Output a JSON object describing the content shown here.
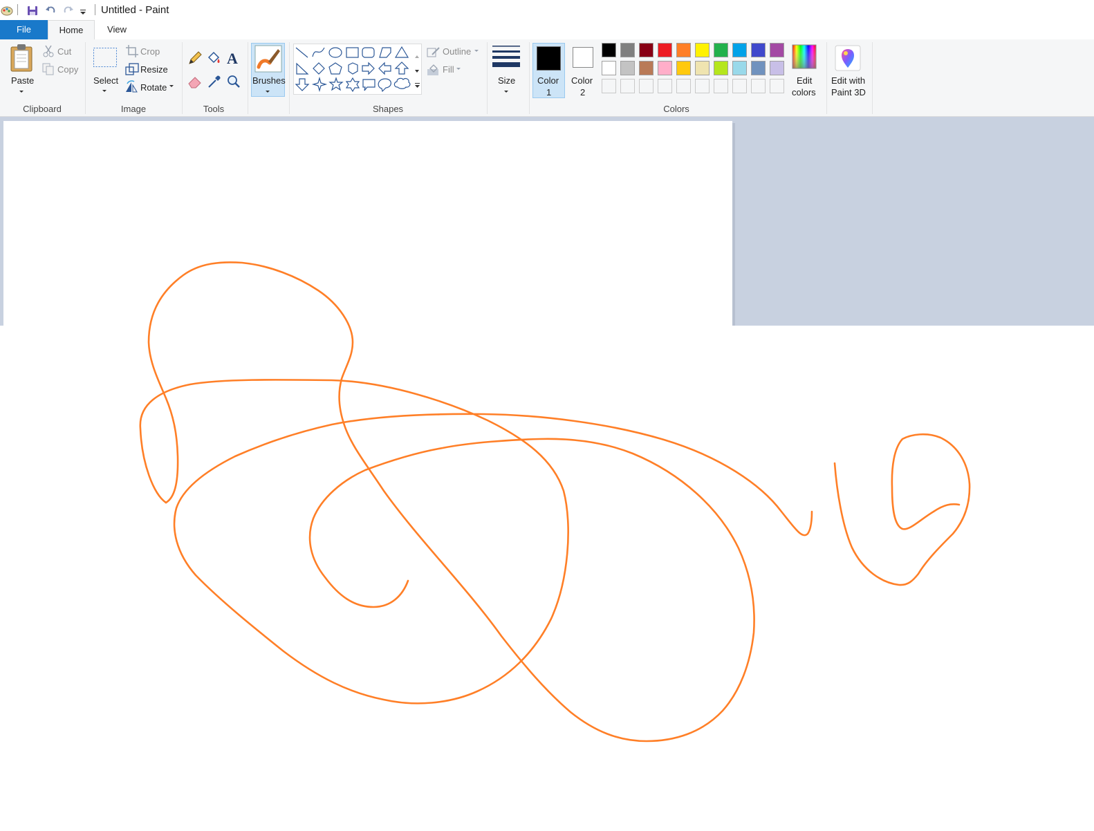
{
  "window": {
    "title": "Untitled - Paint"
  },
  "quick_access": {
    "icons": [
      "paint-app-icon",
      "save-icon",
      "undo-icon",
      "redo-icon",
      "customize-dropdown-icon"
    ]
  },
  "tabs": {
    "file": "File",
    "home": "Home",
    "view": "View",
    "active": "Home"
  },
  "ribbon": {
    "clipboard": {
      "group": "Clipboard",
      "paste": "Paste",
      "cut": "Cut",
      "copy": "Copy"
    },
    "image": {
      "group": "Image",
      "select": "Select",
      "crop": "Crop",
      "resize": "Resize",
      "rotate": "Rotate"
    },
    "tools": {
      "group": "Tools",
      "icons": [
        "pencil-icon",
        "fill-bucket-icon",
        "text-icon",
        "eraser-icon",
        "color-picker-icon",
        "magnifier-icon"
      ]
    },
    "brushes": {
      "label": "Brushes"
    },
    "shapes": {
      "group": "Shapes",
      "outline": "Outline",
      "fill": "Fill",
      "items": [
        "line",
        "curve",
        "oval",
        "rectangle",
        "rounded-rectangle",
        "polygon",
        "triangle",
        "right-triangle",
        "diamond",
        "pentagon",
        "hexagon",
        "right-arrow",
        "left-arrow",
        "up-arrow",
        "down-arrow",
        "four-point-star",
        "five-point-star",
        "six-point-star",
        "rounded-callout",
        "oval-callout",
        "cloud-callout"
      ]
    },
    "size": {
      "label": "Size"
    },
    "colors": {
      "group": "Colors",
      "color1_line1": "Color",
      "color1_line2": "1",
      "color2_line1": "Color",
      "color2_line2": "2",
      "color1_value": "#000000",
      "color2_value": "#ffffff",
      "edit_line1": "Edit",
      "edit_line2": "colors",
      "palette_row1": [
        "#000000",
        "#7f7f7f",
        "#880015",
        "#ed1c24",
        "#ff7f27",
        "#fff200",
        "#22b14c",
        "#00a2e8",
        "#3f48cc",
        "#a349a4"
      ],
      "palette_row2": [
        "#ffffff",
        "#c3c3c3",
        "#b97a57",
        "#ffaec9",
        "#ffc90e",
        "#efe4b0",
        "#b5e61d",
        "#99d9ea",
        "#7092be",
        "#c8bfe7"
      ]
    },
    "paint3d": {
      "line1": "Edit with",
      "line2": "Paint 3D"
    }
  },
  "canvas": {
    "background": "#ffffff",
    "workspace_color": "#c8d1e0",
    "stroke_color": "#ff7f27"
  }
}
